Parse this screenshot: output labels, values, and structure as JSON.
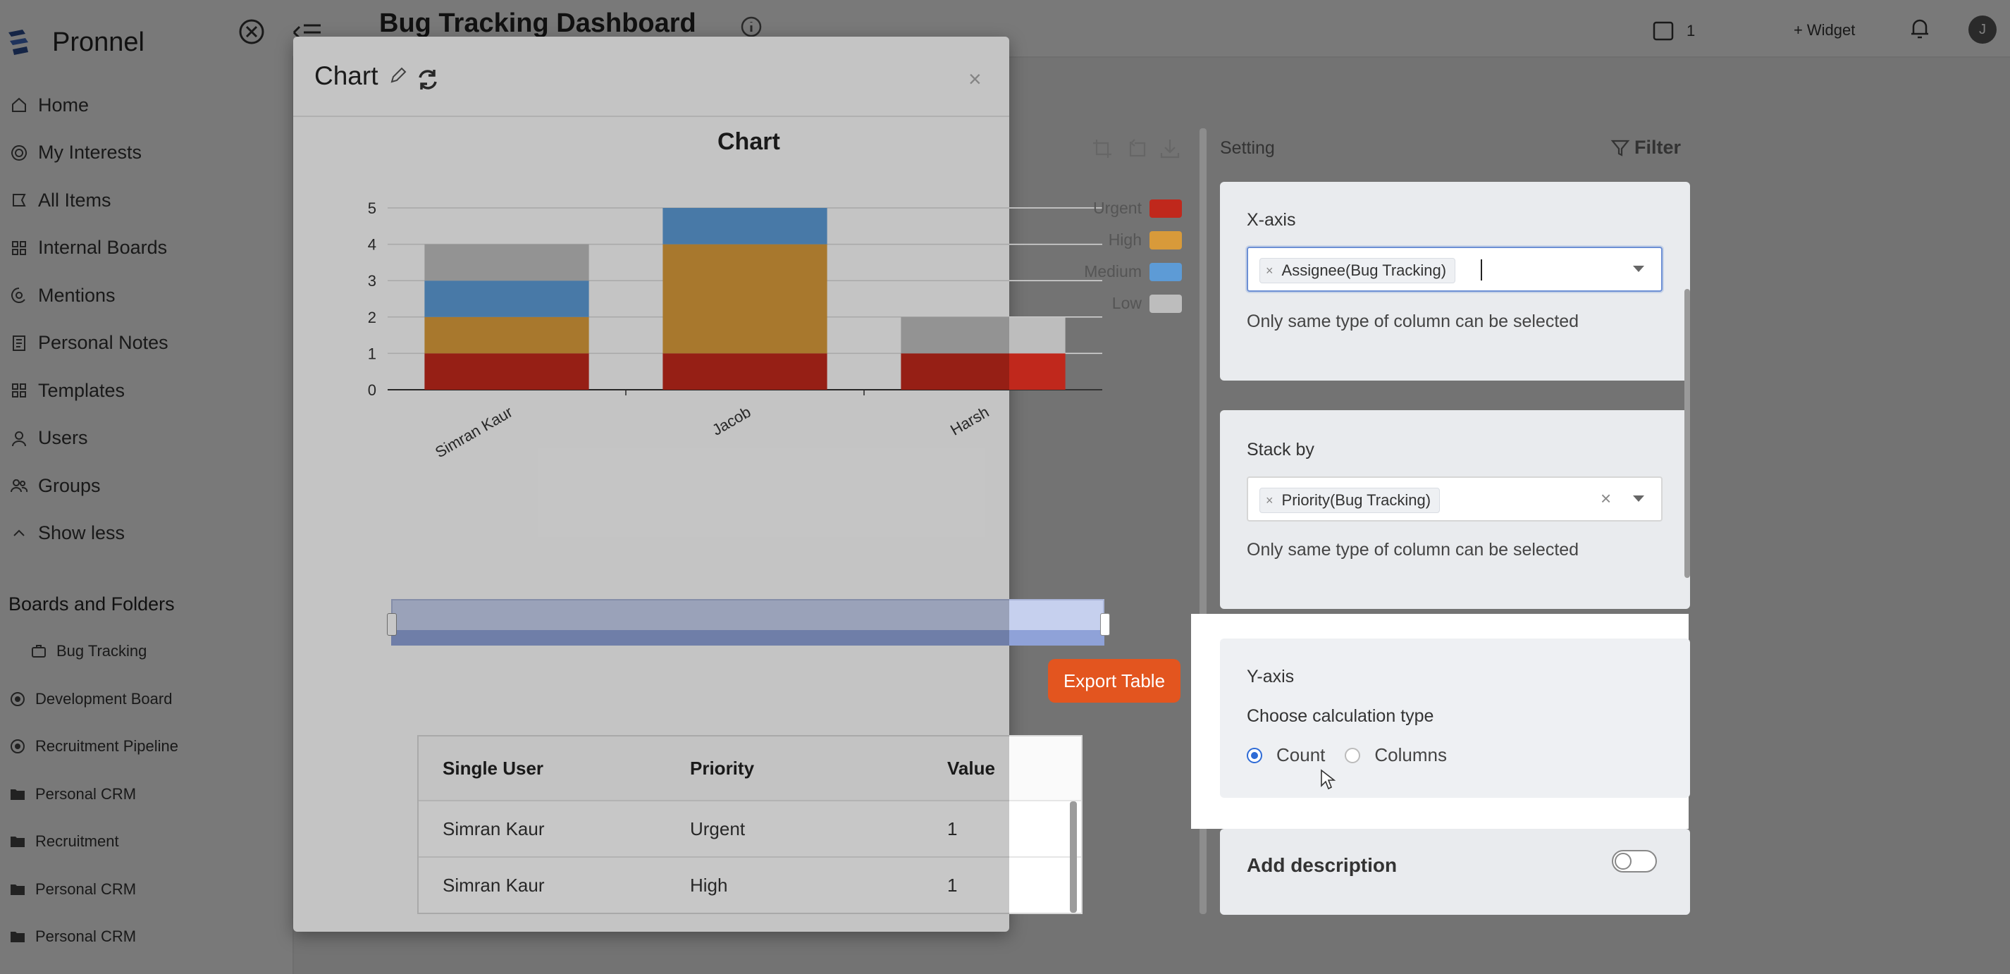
{
  "app": {
    "name": "Pronnel",
    "page_title": "Bug Tracking Dashboard",
    "header_items": {
      "count": "1",
      "widget": "Widget",
      "avatar_letter": "J"
    }
  },
  "sidebar": {
    "nav": [
      {
        "label": "Home",
        "icon": "home-icon"
      },
      {
        "label": "My Interests",
        "icon": "interests-icon"
      },
      {
        "label": "All Items",
        "icon": "items-icon"
      },
      {
        "label": "Internal Boards",
        "icon": "boards-icon"
      },
      {
        "label": "Mentions",
        "icon": "at-icon"
      },
      {
        "label": "Personal Notes",
        "icon": "notes-icon"
      },
      {
        "label": "Templates",
        "icon": "templates-icon"
      },
      {
        "label": "Users",
        "icon": "user-icon"
      },
      {
        "label": "Groups",
        "icon": "group-icon"
      },
      {
        "label": "Show less",
        "icon": "chevron-up-icon"
      }
    ],
    "section_title": "Boards and Folders",
    "folders": [
      {
        "label": "Bug Tracking",
        "icon": "board-icon"
      },
      {
        "label": "Development Board",
        "icon": "board-icon"
      },
      {
        "label": "Recruitment Pipeline",
        "icon": "board-icon"
      },
      {
        "label": "Personal CRM",
        "icon": "folder-icon"
      },
      {
        "label": "Recruitment",
        "icon": "folder-icon"
      },
      {
        "label": "Personal CRM",
        "icon": "folder-icon"
      },
      {
        "label": "Personal CRM",
        "icon": "folder-icon"
      }
    ]
  },
  "modal": {
    "title": "Chart",
    "close": "×",
    "export_label": "Export Table",
    "table": {
      "headers": [
        "Single User",
        "Priority",
        "Value"
      ],
      "rows": [
        [
          "Simran Kaur",
          "Urgent",
          "1"
        ],
        [
          "Simran Kaur",
          "High",
          "1"
        ]
      ]
    }
  },
  "settings": {
    "label": "Setting",
    "filter_label": "Filter",
    "x_axis": {
      "label": "X-axis",
      "chip": "Assignee(Bug Tracking)",
      "hint": "Only same type of column can be selected"
    },
    "stack_by": {
      "label": "Stack by",
      "chip": "Priority(Bug Tracking)",
      "hint": "Only same type of column can be selected"
    },
    "y_axis": {
      "label": "Y-axis",
      "calc_label": "Choose calculation type",
      "options": [
        "Count",
        "Columns"
      ],
      "selected": "Count"
    },
    "description_label": "Add description"
  },
  "chart_data": {
    "type": "bar",
    "stacked": true,
    "title": "Chart",
    "categories": [
      "Simran Kaur",
      "Jacob",
      "Harsh"
    ],
    "series": [
      {
        "name": "Urgent",
        "color": "#c0281c",
        "values": [
          1,
          1,
          1
        ]
      },
      {
        "name": "High",
        "color": "#d89a3a",
        "values": [
          1,
          3,
          0
        ]
      },
      {
        "name": "Medium",
        "color": "#5d9bd6",
        "values": [
          1,
          1,
          0
        ]
      },
      {
        "name": "Low",
        "color": "#bdbdbd",
        "values": [
          1,
          0,
          1
        ]
      }
    ],
    "yticks": [
      "0",
      "1",
      "2",
      "3",
      "4",
      "5"
    ],
    "ylim": [
      0,
      5
    ],
    "legend_position": "top-right",
    "grid": true
  }
}
